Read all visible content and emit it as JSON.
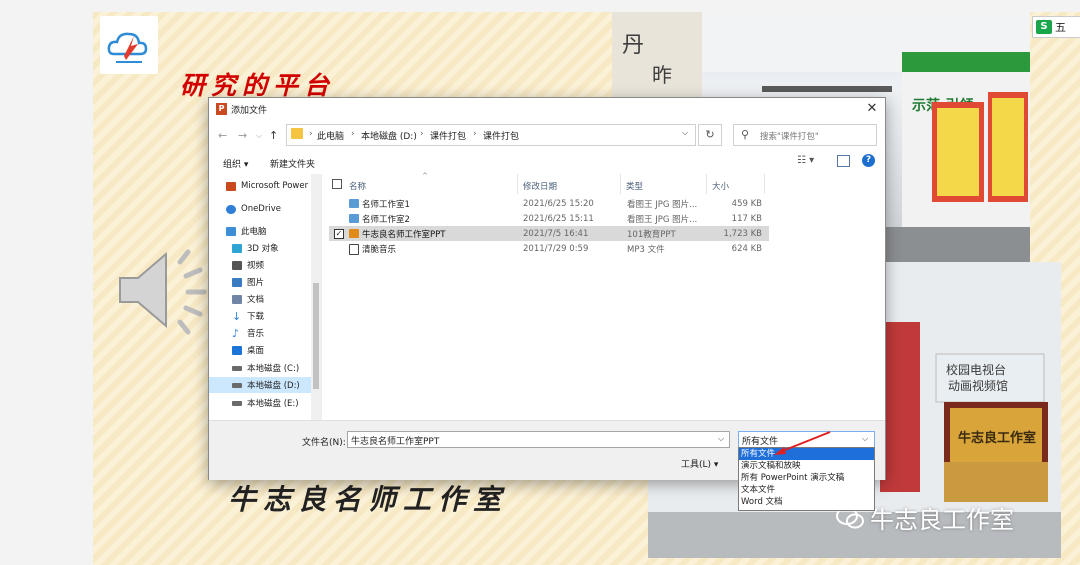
{
  "slide": {
    "title": "研究的平台",
    "caption": "牛志良名师工作室"
  },
  "watermark": {
    "text": "牛志良工作室"
  },
  "wps_tab": {
    "label": "五",
    "logo_letter": "S"
  },
  "photo": {
    "sign_top": "示范·引领·",
    "sign_bottom_1": "校园电视台",
    "sign_bottom_2": "动画视频馆",
    "plaque": "牛志良工作室"
  },
  "dialog": {
    "title": "添加文件",
    "breadcrumb": [
      "此电脑",
      "本地磁盘 (D:)",
      "课件打包",
      "课件打包"
    ],
    "search_placeholder": "搜索\"课件打包\"",
    "toolbar": {
      "organize": "组织 ▾",
      "new_folder": "新建文件夹"
    },
    "nav_items": [
      {
        "label": "Microsoft Power",
        "color": "#c94a1f"
      },
      {
        "label": "OneDrive",
        "color": "#2f7fd6"
      },
      {
        "label": "此电脑",
        "color": "#3c8fd6"
      },
      {
        "label": "3D 对象",
        "color": "#2fa5d6"
      },
      {
        "label": "视频",
        "color": "#555555"
      },
      {
        "label": "图片",
        "color": "#3a7cc4"
      },
      {
        "label": "文档",
        "color": "#6f86a6"
      },
      {
        "label": "下载",
        "color": "#2f7fd6"
      },
      {
        "label": "音乐",
        "color": "#2f7fd6"
      },
      {
        "label": "桌面",
        "color": "#1d74d8"
      },
      {
        "label": "本地磁盘 (C:)",
        "color": "#6a6a6a"
      },
      {
        "label": "本地磁盘 (D:)",
        "color": "#6a6a6a"
      },
      {
        "label": "本地磁盘 (E:)",
        "color": "#6a6a6a"
      }
    ],
    "columns": {
      "name": "名称",
      "date": "修改日期",
      "type": "类型",
      "size": "大小"
    },
    "files": [
      {
        "name": "名师工作室1",
        "date": "2021/6/25 15:20",
        "type": "看图王 JPG 图片...",
        "size": "459 KB",
        "icon": "image-icon",
        "color": "#5b9bd5",
        "checked": false
      },
      {
        "name": "名师工作室2",
        "date": "2021/6/25 15:11",
        "type": "看图王 JPG 图片...",
        "size": "117 KB",
        "icon": "image-icon",
        "color": "#5b9bd5",
        "checked": false
      },
      {
        "name": "牛志良名师工作室PPT",
        "date": "2021/7/5 16:41",
        "type": "101教育PPT",
        "size": "1,723 KB",
        "icon": "ppt-icon",
        "color": "#e08a1a",
        "checked": true
      },
      {
        "name": "清脆音乐",
        "date": "2011/7/29 0:59",
        "type": "MP3 文件",
        "size": "624 KB",
        "icon": "music-file-icon",
        "color": "#444444",
        "checked": false
      }
    ],
    "filename_label": "文件名(N):",
    "filename_value": "牛志良名师工作室PPT",
    "filetype_value": "所有文件",
    "tools_label": "工具(L) ▾",
    "filetype_options": [
      "所有文件",
      "演示文稿和放映",
      "所有 PowerPoint 演示文稿",
      "文本文件",
      "Word 文档"
    ]
  }
}
